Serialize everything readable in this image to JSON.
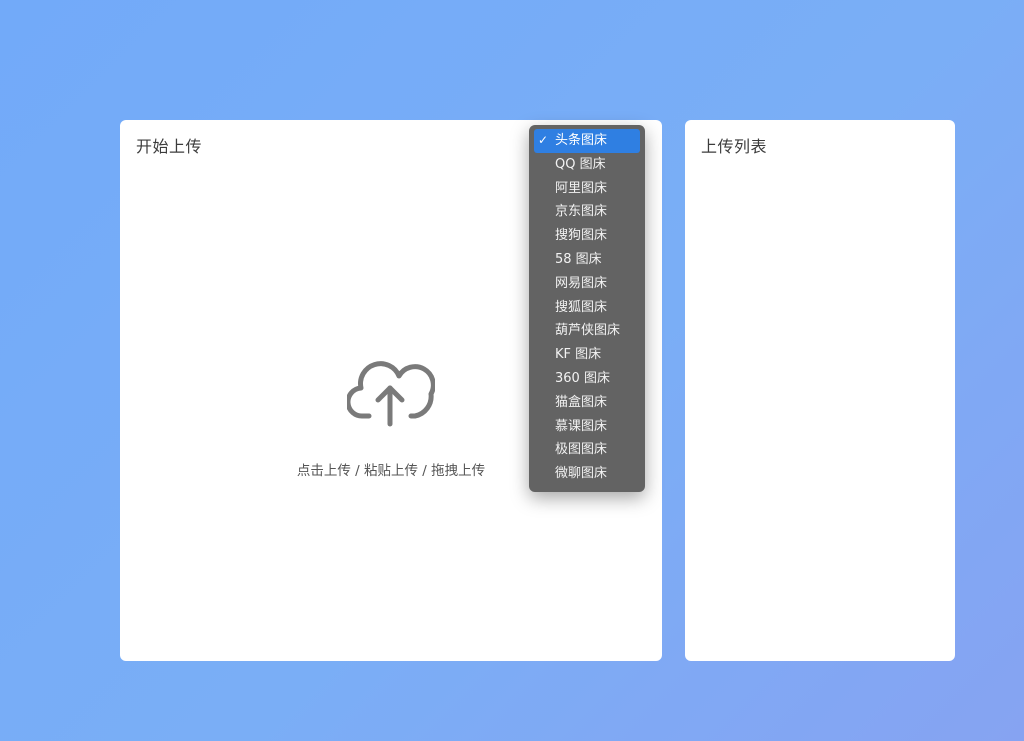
{
  "upload_panel": {
    "title": "开始上传",
    "hint": "点击上传 / 粘贴上传 / 拖拽上传",
    "icon": "cloud-upload-icon"
  },
  "list_panel": {
    "title": "上传列表"
  },
  "host_dropdown": {
    "check_mark": "✓",
    "selected_index": 0,
    "options": [
      {
        "label": "头条图床"
      },
      {
        "label": "QQ 图床"
      },
      {
        "label": "阿里图床"
      },
      {
        "label": "京东图床"
      },
      {
        "label": "搜狗图床"
      },
      {
        "label": "58 图床"
      },
      {
        "label": "网易图床"
      },
      {
        "label": "搜狐图床"
      },
      {
        "label": "葫芦侠图床"
      },
      {
        "label": "KF 图床"
      },
      {
        "label": "360 图床"
      },
      {
        "label": "猫盒图床"
      },
      {
        "label": "慕课图床"
      },
      {
        "label": "极图图床"
      },
      {
        "label": "微聊图床"
      }
    ]
  },
  "colors": {
    "background": "#74abf8",
    "panel": "#ffffff",
    "menu": "#636363",
    "menu_highlight": "#2f7fe2",
    "icon": "#7a7a7a"
  }
}
